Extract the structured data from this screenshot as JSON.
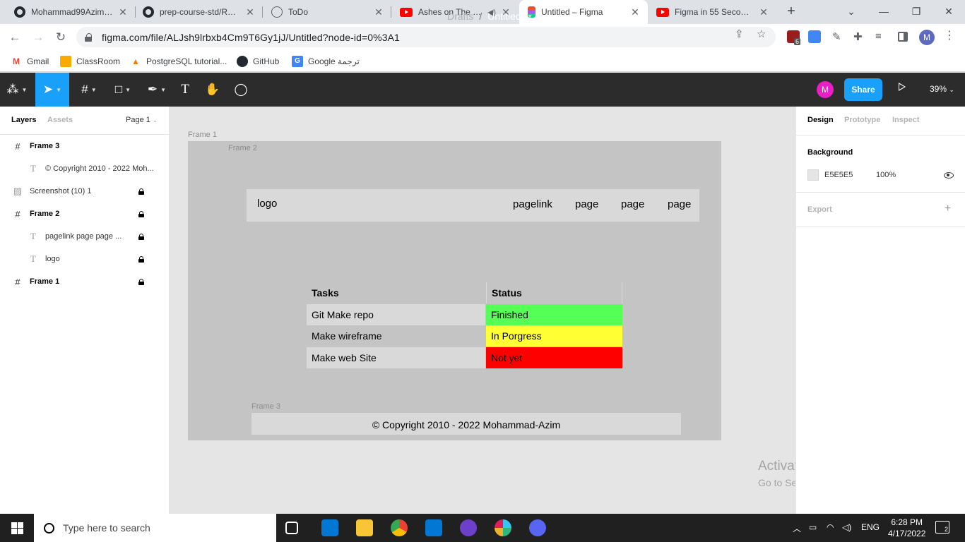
{
  "browser": {
    "tabs": [
      {
        "title": "Mohammad99Azim/to",
        "icon": "github-icon",
        "active": false
      },
      {
        "title": "prep-course-std/READ",
        "icon": "github-icon",
        "active": false
      },
      {
        "title": "ToDo",
        "icon": "globe-icon",
        "active": false
      },
      {
        "title": "Ashes on The Fire",
        "icon": "youtube-icon",
        "active": false,
        "audio": true
      },
      {
        "title": "Untitled – Figma",
        "icon": "figma-icon",
        "active": true
      },
      {
        "title": "Figma in 55 Seconds",
        "icon": "youtube-icon",
        "active": false
      }
    ],
    "url": "figma.com/file/ALJsh9lrbxb4Cm9T6Gy1jJ/Untitled?node-id=0%3A1",
    "profile_initial": "M",
    "extension_badge": "6",
    "bookmarks": [
      {
        "label": "Gmail",
        "icon": "gmail-icon"
      },
      {
        "label": "ClassRoom",
        "icon": "classroom-icon"
      },
      {
        "label": "PostgreSQL tutorial...",
        "icon": "postgres-icon"
      },
      {
        "label": "GitHub",
        "icon": "github-icon"
      },
      {
        "label": "Google ترجمة",
        "icon": "translate-icon"
      }
    ]
  },
  "figma": {
    "breadcrumb": {
      "parent": "Drafts",
      "separator": "/",
      "title": "Untitled"
    },
    "avatar_initial": "M",
    "share_label": "Share",
    "zoom": "39%",
    "left_panel": {
      "tabs": [
        "Layers",
        "Assets"
      ],
      "page": "Page 1",
      "layers": [
        {
          "name": "Frame 3",
          "type": "frame",
          "indent": 0,
          "locked": false
        },
        {
          "name": "© Copyright 2010 - 2022 Moh...",
          "type": "text",
          "indent": 1,
          "locked": false
        },
        {
          "name": "Screenshot (10) 1",
          "type": "image",
          "indent": 0,
          "locked": true
        },
        {
          "name": "Frame 2",
          "type": "frame",
          "indent": 0,
          "locked": true
        },
        {
          "name": "pagelink page page ...",
          "type": "text",
          "indent": 1,
          "locked": true
        },
        {
          "name": "logo",
          "type": "text",
          "indent": 1,
          "locked": true
        },
        {
          "name": "Frame 1",
          "type": "frame",
          "indent": 0,
          "locked": true
        }
      ]
    },
    "canvas": {
      "frame1_label": "Frame 1",
      "frame2_label": "Frame 2",
      "frame3_label": "Frame 3",
      "nav_logo": "logo",
      "nav_links": [
        "pagelink",
        "page",
        "page",
        "page"
      ],
      "table": {
        "headers": [
          "Tasks",
          "Status"
        ],
        "rows": [
          {
            "task": "Git Make repo",
            "status": "Finished",
            "status_color": "#55ff55"
          },
          {
            "task": "Make wireframe",
            "status": "In Porgress",
            "status_color": "#ffff33"
          },
          {
            "task": "Make web Site",
            "status": "Not yet",
            "status_color": "#ff0000"
          }
        ]
      },
      "footer_text": "© Copyright 2010 - 2022 Mohammad-Azim"
    },
    "right_panel": {
      "tabs": [
        "Design",
        "Prototype",
        "Inspect"
      ],
      "background_heading": "Background",
      "background_hex": "E5E5E5",
      "background_opacity": "100%",
      "export_heading": "Export"
    }
  },
  "os": {
    "watermark_title": "Activate Windows",
    "watermark_sub": "Go to Settings to activate Windows.",
    "search_placeholder": "Type here to search",
    "language": "ENG",
    "time": "6:28 PM",
    "date": "4/17/2022",
    "notification_count": "2"
  },
  "colors": {
    "accent": "#18a0fb",
    "toolbar": "#2c2c2c",
    "canvas": "#e5e5e5",
    "frame": "#c4c4c4"
  }
}
